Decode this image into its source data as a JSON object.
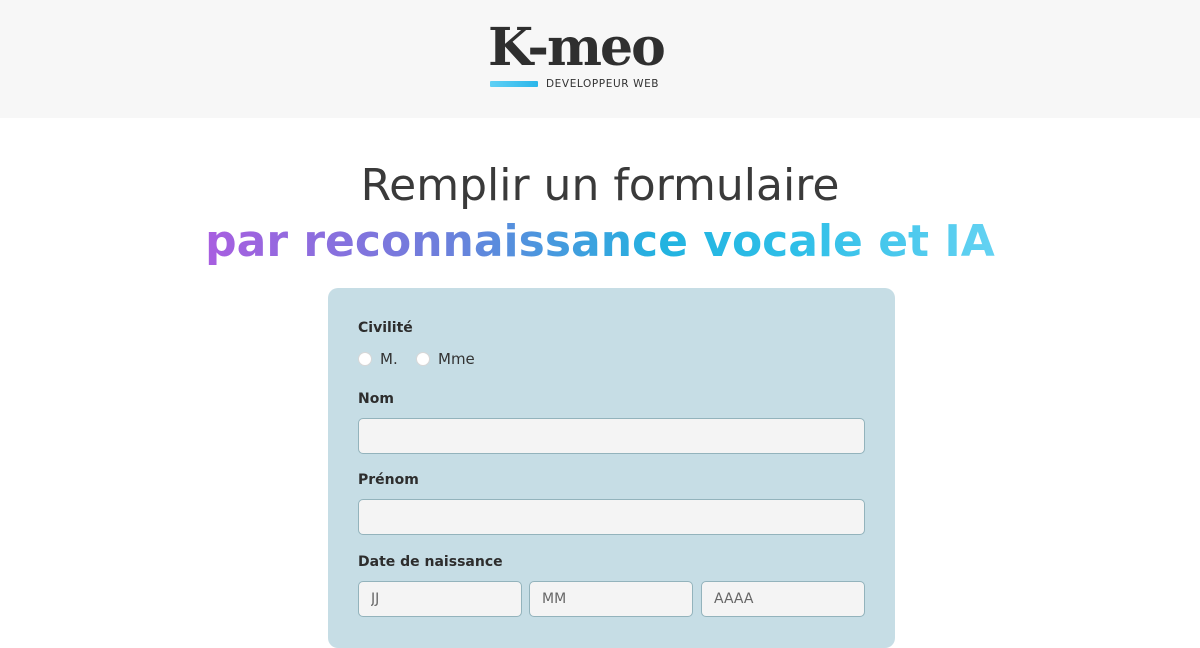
{
  "brand": {
    "logo_text": "K-meo",
    "tagline": "DEVELOPPEUR WEB"
  },
  "headline": {
    "line1": "Remplir un formulaire",
    "line2": "par reconnaissance vocale et IA"
  },
  "form": {
    "civility": {
      "label": "Civilité",
      "options": [
        "M.",
        "Mme"
      ]
    },
    "last_name": {
      "label": "Nom",
      "value": ""
    },
    "first_name": {
      "label": "Prénom",
      "value": ""
    },
    "birth_date": {
      "label": "Date de naissance",
      "day_placeholder": "JJ",
      "month_placeholder": "MM",
      "year_placeholder": "AAAA"
    }
  },
  "colors": {
    "card_background": "#c6dde5",
    "gradient_start": "#a85ee0",
    "gradient_mid": "#22b3e0",
    "gradient_end": "#64d2f2"
  }
}
